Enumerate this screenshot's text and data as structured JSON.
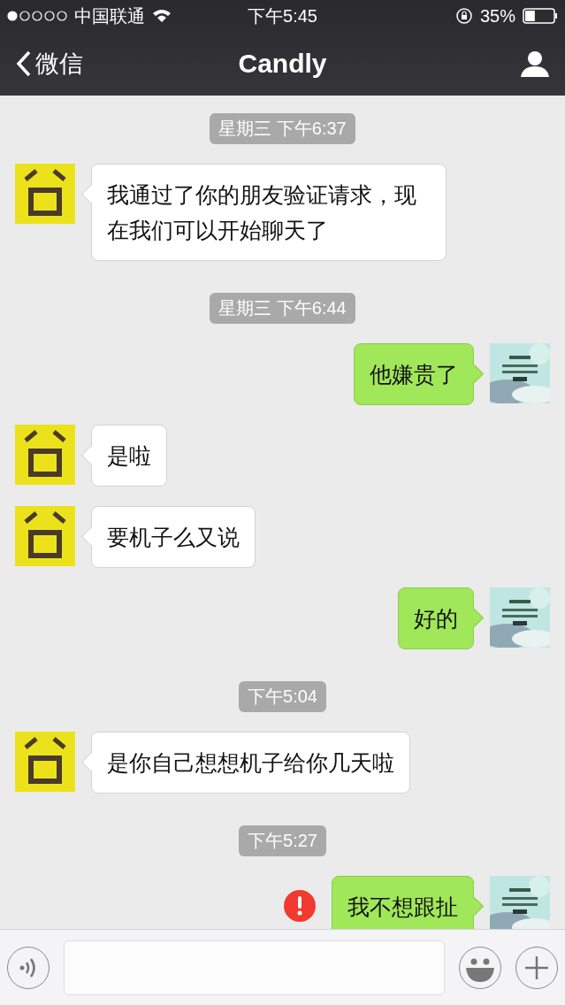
{
  "status_bar": {
    "carrier": "中国联通",
    "time": "下午5:45",
    "battery": "35%"
  },
  "nav": {
    "back": "微信",
    "title": "Candly"
  },
  "messages": [
    {
      "kind": "time",
      "text": "星期三 下午6:37"
    },
    {
      "kind": "message",
      "outgoing": false,
      "text": "我通过了你的朋友验证请求，现在我们可以开始聊天了",
      "failed": false
    },
    {
      "kind": "time",
      "text": "星期三 下午6:44"
    },
    {
      "kind": "message",
      "outgoing": true,
      "text": "他嫌贵了",
      "failed": false
    },
    {
      "kind": "message",
      "outgoing": false,
      "text": "是啦",
      "failed": false
    },
    {
      "kind": "message",
      "outgoing": false,
      "text": "要机子么又说",
      "failed": false
    },
    {
      "kind": "message",
      "outgoing": true,
      "text": "好的",
      "failed": false
    },
    {
      "kind": "time",
      "text": "下午5:04"
    },
    {
      "kind": "message",
      "outgoing": false,
      "text": "是你自己想想机子给你几天啦",
      "failed": false
    },
    {
      "kind": "time",
      "text": "下午5:27"
    },
    {
      "kind": "message",
      "outgoing": true,
      "text": "我不想跟扯",
      "failed": true
    }
  ]
}
